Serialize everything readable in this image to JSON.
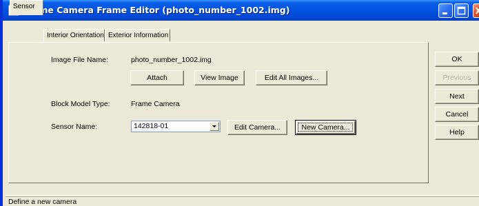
{
  "window": {
    "title": "Frame Camera Frame Editor (photo_number_1002.img)",
    "accent_color": "#0054e3"
  },
  "tabs": [
    {
      "label": "Sensor",
      "active": true
    },
    {
      "label": "Interior Orientation",
      "active": false
    },
    {
      "label": "Exterior Information",
      "active": false
    }
  ],
  "sensor": {
    "image_file_label": "Image File Name:",
    "image_file_value": "photo_number_1002.img",
    "attach_label": "Attach",
    "view_image_label": "View Image",
    "edit_all_label": "Edit All Images...",
    "block_model_label": "Block Model Type:",
    "block_model_value": "Frame Camera",
    "sensor_name_label": "Sensor Name:",
    "sensor_name_value": "142818-01",
    "edit_camera_label": "Edit Camera...",
    "new_camera_label": "New Camera..."
  },
  "side_buttons": {
    "ok": "OK",
    "previous": "Previous",
    "next": "Next",
    "cancel": "Cancel",
    "help": "Help"
  },
  "status": {
    "text": "Define a new camera"
  }
}
